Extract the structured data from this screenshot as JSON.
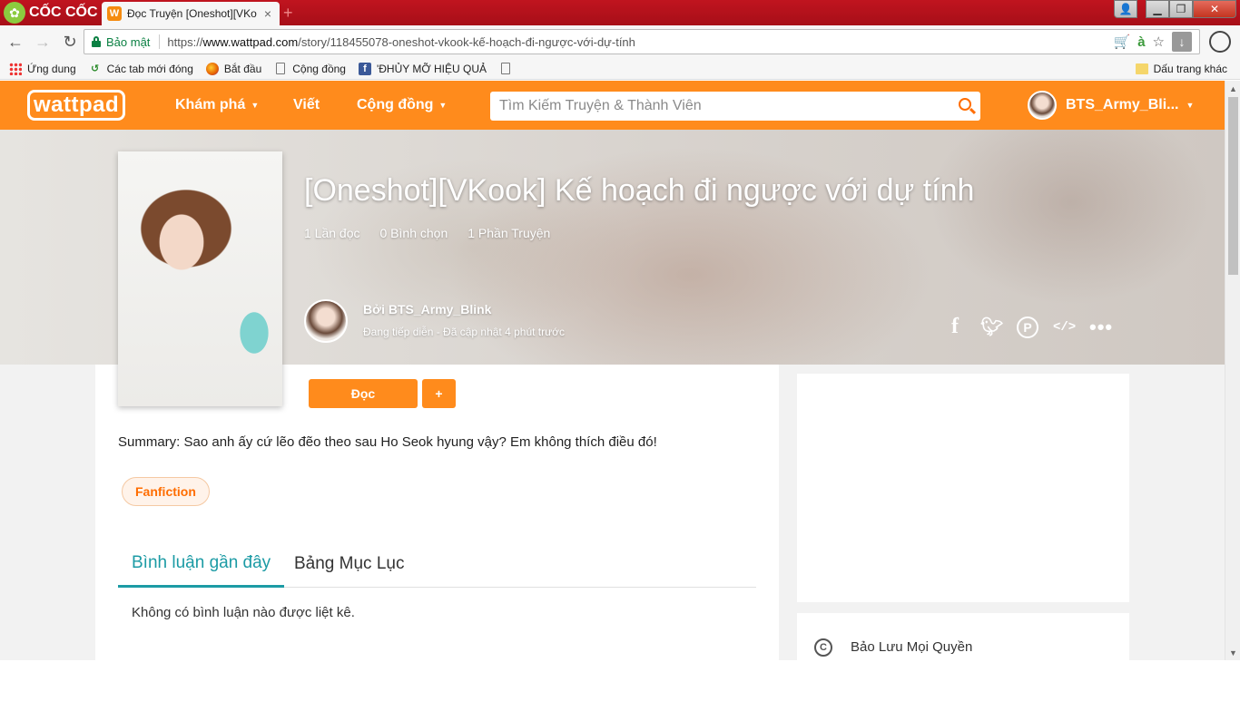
{
  "browser": {
    "brand_name": "CỐC CỐC",
    "tab_title": "Đọc Truyện [Oneshot][VKo",
    "tab_close": "×",
    "new_tab": "+",
    "secure_label": "Bảo mật",
    "url_prefix": "https://",
    "url_host": "www.wattpad.com",
    "url_path": "/story/118455078-oneshot-vkook-kế-hoạch-đi-ngược-với-dự-tính",
    "bookmarks": [
      {
        "label": "Ứng dung",
        "icon": "apps-icon"
      },
      {
        "label": "Các tab mới đóng",
        "icon": "history-icon"
      },
      {
        "label": "Bắt đầu",
        "icon": "firefox-icon"
      },
      {
        "label": "Cộng đồng",
        "icon": "page-icon"
      },
      {
        "label": "'ĐHỦY MỠ HIỆU QUẢ",
        "icon": "facebook-icon"
      },
      {
        "label": "",
        "icon": "page-icon"
      }
    ],
    "other_bookmarks": "Dấu trang khác"
  },
  "wattpad": {
    "logo": "wattpad",
    "nav": {
      "explore": "Khám phá",
      "write": "Viết",
      "community": "Cộng đồng"
    },
    "search_placeholder": "Tìm Kiếm Truyện & Thành Viên",
    "username": "BTS_Army_Bli..."
  },
  "story": {
    "title": "[Oneshot][VKook] Kế hoạch đi ngược với dự tính",
    "reads": "1 Lần đọc",
    "votes": "0 Bình chọn",
    "parts": "1 Phần Truyện",
    "author_line": "Bởi BTS_Army_Blink",
    "status_line": "Đang tiếp diễn - Đã cập nhật 4 phút trước",
    "read_button": "Đọc",
    "add_button": "+",
    "summary": "Summary: Sao anh ấy cứ lẽo đẽo theo sau Ho Seok hyung vậy? Em không thích điều đó!",
    "tag": "Fanfiction",
    "tabs": [
      "Bình luận gần đây",
      "Bảng Mục Lục"
    ],
    "no_comments": "Không có bình luận nào được liệt kê.",
    "copyright": "Bảo Lưu Mọi Quyền"
  },
  "colors": {
    "wattpad_orange": "#ff8b1c",
    "tab_active": "#1c9ba5",
    "titlebar_red": "#b3121c"
  }
}
